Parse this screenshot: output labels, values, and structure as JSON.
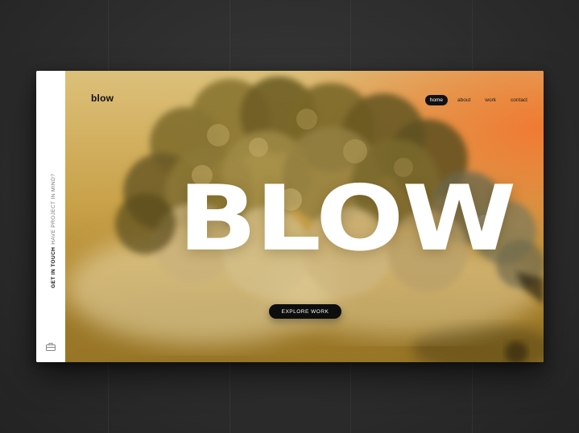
{
  "brand": {
    "logo": "blow"
  },
  "nav": {
    "items": [
      {
        "label": "home",
        "active": true
      },
      {
        "label": "about",
        "active": false
      },
      {
        "label": "work",
        "active": false
      },
      {
        "label": "contact",
        "active": false
      }
    ]
  },
  "hero": {
    "headline": "BLOW",
    "cta_label": "EXPLORE WORK"
  },
  "sidebar": {
    "primary_text": "GET IN TOUCH",
    "secondary_text": "HAVE PROJECT IN MIND?",
    "icon": "briefcase-icon"
  },
  "colors": {
    "accent": "#f07a32",
    "dark": "#111111",
    "smoke": "#6b5a24"
  }
}
